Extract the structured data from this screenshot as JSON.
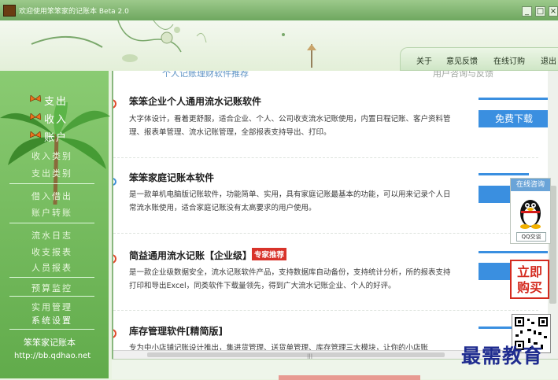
{
  "window": {
    "title": "欢迎使用笨笨家的记账本 Beta 2.0",
    "buttons": [
      "_",
      "□",
      "×"
    ]
  },
  "top_menu": {
    "items": [
      "关于",
      "意见反馈",
      "在线订购",
      "退出"
    ]
  },
  "sidebar": {
    "main_items": [
      "支出",
      "收入",
      "账户"
    ],
    "groups": [
      [
        "收入类别",
        "支出类别"
      ],
      [
        "借入借出",
        "账户转账"
      ],
      [
        "流水日志",
        "收支报表",
        "人员报表"
      ],
      [
        "预算监控"
      ],
      [
        "实用管理",
        "系统设置"
      ]
    ],
    "footer_title": "笨笨家记账本",
    "footer_url": "http://bb.qdhao.net"
  },
  "content": {
    "partial_heading_left": "个人记账理财软件推荐",
    "partial_heading_right": "用户咨询与反馈",
    "items": [
      {
        "title": "笨笨企业个人通用流水记账软件",
        "desc": "大字体设计，看着更舒服，适合企业、个人、公司收支流水记账使用，内置日程记账、客户资料管理、报表单管理、流水记账管理，全部报表支持导出、打印。",
        "button": "免费下载"
      },
      {
        "title": "笨笨家庭记账本软件",
        "desc": "是一款单机电脑版记账软件，功能简单、实用，具有家庭记账最基本的功能，可以用来记录个人日常流水账使用，适合家庭记账没有太高要求的用户使用。"
      },
      {
        "title": "简益通用流水记账【企业级】",
        "badge": "专家推荐",
        "desc": "是一款企业级数据安全，流水记账软件产品，支持数据库自动备份，支持统计分析，所的报表支持打印和导出Excel，同类软件下载量领先，得到广大流水记账企业、个人的好评。"
      },
      {
        "title": "库存管理软件[精简版]",
        "desc": "专为中小店铺记账设计推出，集进货管理、送货单管理、库存管理三大模块，让你的小店账"
      }
    ]
  },
  "widgets": {
    "qq_header": "在线咨询",
    "qq_footer": "QQ交谈",
    "buy_now": [
      "立即",
      "购买"
    ]
  },
  "watermark": "最需教育",
  "colors": {
    "sidebar_green": "#6db555",
    "download_blue": "#3a8fe0",
    "badge_red": "#d8332a"
  }
}
